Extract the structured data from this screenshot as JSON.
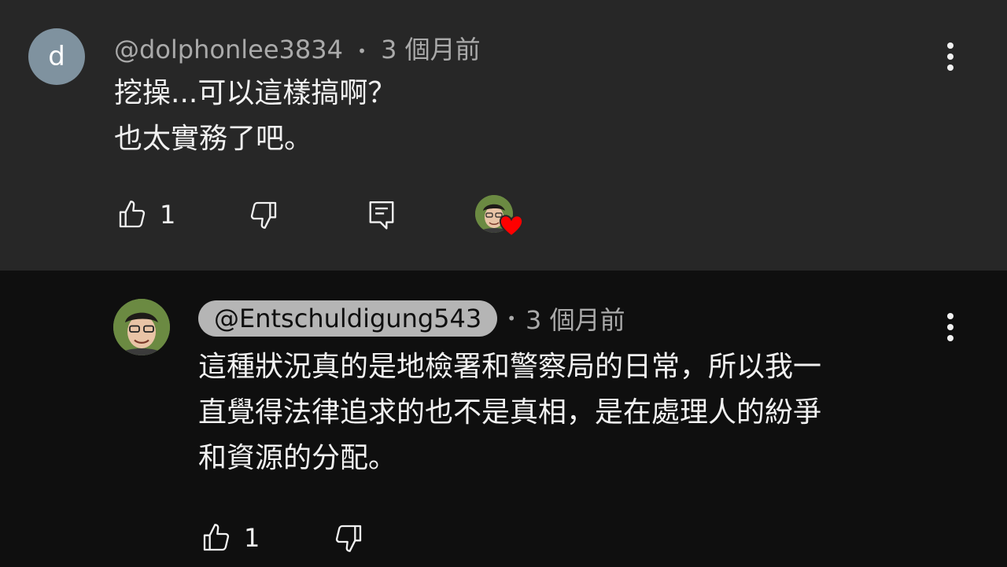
{
  "comments": [
    {
      "avatar_letter": "d",
      "handle": "@dolphonlee3834",
      "separator": "•",
      "time": "3 個月前",
      "lines": [
        "挖操...可以這樣搞啊？",
        "也太實務了吧。"
      ],
      "like_count": "1",
      "icons": {
        "like": "thumb-up-icon",
        "dislike": "thumb-down-icon",
        "reply": "comment-reply-icon",
        "more": "more-vert-icon",
        "heart": "creator-heart-icon"
      }
    },
    {
      "handle": "@Entschuldigung543",
      "separator": "•",
      "time": "3 個月前",
      "lines": [
        "這種狀況真的是地檢署和警察局的日常，所以我一",
        "直覺得法律追求的也不是真相，是在處理人的紛爭",
        "和資源的分配。"
      ],
      "like_count": "1",
      "icons": {
        "like": "thumb-up-icon",
        "dislike": "thumb-down-icon",
        "more": "more-vert-icon"
      }
    }
  ],
  "colors": {
    "highlight_bg": "#272727",
    "page_bg": "#0f0f0f",
    "heart": "#ff0000",
    "pill_bg": "#b5b5b5"
  }
}
